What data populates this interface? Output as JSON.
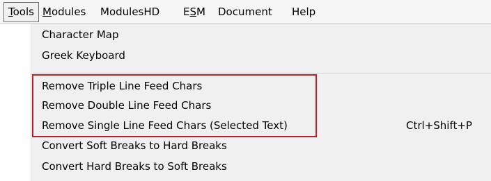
{
  "menubar": {
    "items": [
      {
        "pre": "",
        "accel": "T",
        "post": "ools"
      },
      {
        "pre": "",
        "accel": "M",
        "post": "odules"
      },
      {
        "pre": "ModulesHD",
        "accel": "",
        "post": ""
      },
      {
        "pre": "E",
        "accel": "S",
        "post": "M"
      },
      {
        "pre": "Document",
        "accel": "",
        "post": ""
      },
      {
        "pre": "Help",
        "accel": "",
        "post": ""
      }
    ]
  },
  "tools_menu": {
    "items": [
      {
        "label": "Character Map",
        "shortcut": ""
      },
      {
        "label": "Greek Keyboard",
        "shortcut": ""
      },
      {
        "label": "Remove Triple Line Feed Chars",
        "shortcut": ""
      },
      {
        "label": "Remove Double Line Feed Chars",
        "shortcut": ""
      },
      {
        "label": "Remove Single Line Feed Chars (Selected Text)",
        "shortcut": "Ctrl+Shift+P"
      },
      {
        "label": "Convert Soft Breaks to Hard Breaks",
        "shortcut": ""
      },
      {
        "label": "Convert Hard Breaks to Soft Breaks",
        "shortcut": ""
      }
    ]
  },
  "colors": {
    "highlight_border": "#c0202a",
    "menu_background": "#f0f0f0",
    "menubar_background": "#f6f6f6"
  }
}
